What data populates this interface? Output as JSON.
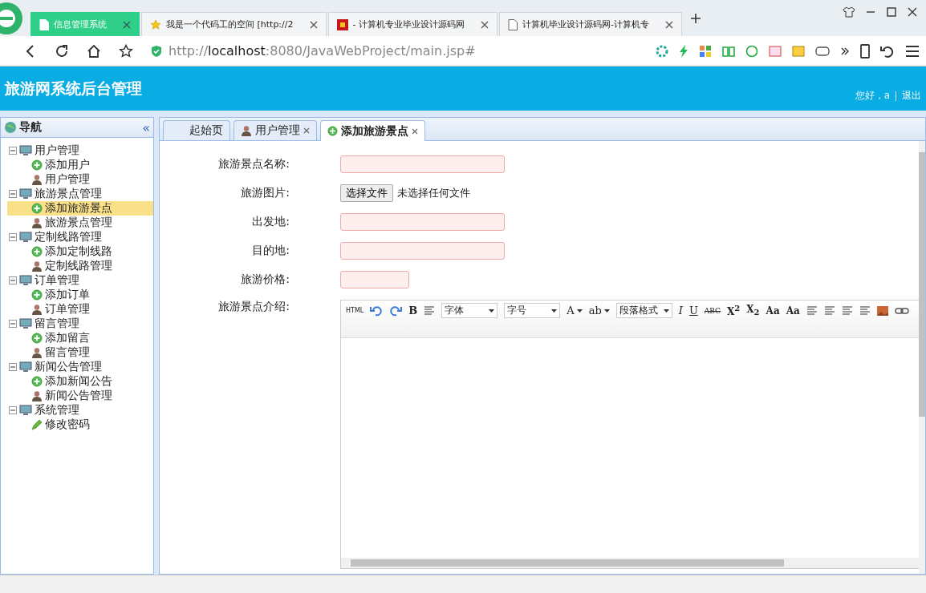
{
  "browser": {
    "tabs": [
      {
        "title": "信息管理系统",
        "selected": true,
        "kind": "page"
      },
      {
        "title": "我是一个代码工的空间 [http://2",
        "selected": false,
        "kind": "star"
      },
      {
        "title": "- 计算机专业毕业设计源码网",
        "selected": false,
        "kind": "favicon"
      },
      {
        "title": "计算机毕业设计源码网-计算机专",
        "selected": false,
        "kind": "page"
      }
    ],
    "url": "http://**localhost**:8080/JavaWebProject/main.jsp#"
  },
  "header": {
    "title": "旅游网系统后台管理",
    "greeting": "您好，a",
    "logout": "退出"
  },
  "nav": {
    "title": "导航",
    "collapse": "«",
    "tree": [
      {
        "label": "用户管理",
        "expanded": true,
        "children": [
          {
            "label": "添加用户",
            "kind": "add",
            "selected": false
          },
          {
            "label": "用户管理",
            "kind": "manage",
            "selected": false
          }
        ]
      },
      {
        "label": "旅游景点管理",
        "expanded": true,
        "children": [
          {
            "label": "添加旅游景点",
            "kind": "add",
            "selected": true
          },
          {
            "label": "旅游景点管理",
            "kind": "manage",
            "selected": false
          }
        ]
      },
      {
        "label": "定制线路管理",
        "expanded": true,
        "children": [
          {
            "label": "添加定制线路",
            "kind": "add",
            "selected": false
          },
          {
            "label": "定制线路管理",
            "kind": "manage",
            "selected": false
          }
        ]
      },
      {
        "label": "订单管理",
        "expanded": true,
        "children": [
          {
            "label": "添加订单",
            "kind": "add",
            "selected": false
          },
          {
            "label": "订单管理",
            "kind": "manage",
            "selected": false
          }
        ]
      },
      {
        "label": "留言管理",
        "expanded": true,
        "children": [
          {
            "label": "添加留言",
            "kind": "add",
            "selected": false
          },
          {
            "label": "留言管理",
            "kind": "manage",
            "selected": false
          }
        ]
      },
      {
        "label": "新闻公告管理",
        "expanded": true,
        "children": [
          {
            "label": "添加新闻公告",
            "kind": "add",
            "selected": false
          },
          {
            "label": "新闻公告管理",
            "kind": "manage",
            "selected": false
          }
        ]
      },
      {
        "label": "系统管理",
        "expanded": true,
        "children": [
          {
            "label": "修改密码",
            "kind": "edit",
            "selected": false
          }
        ]
      }
    ]
  },
  "tabs": [
    {
      "label": "起始页",
      "kind": "plain",
      "closable": false,
      "selected": false
    },
    {
      "label": "用户管理",
      "kind": "manage",
      "closable": true,
      "selected": false
    },
    {
      "label": "添加旅游景点",
      "kind": "add",
      "closable": true,
      "selected": true
    }
  ],
  "form": [
    {
      "label": "旅游景点名称:",
      "kind": "text"
    },
    {
      "label": "旅游图片:",
      "kind": "file",
      "button": "选择文件",
      "status": "未选择任何文件"
    },
    {
      "label": "出发地:",
      "kind": "text"
    },
    {
      "label": "目的地:",
      "kind": "text"
    },
    {
      "label": "旅游价格:",
      "kind": "short"
    },
    {
      "label": "旅游景点介绍:",
      "kind": "editor"
    }
  ],
  "editor_toolbar": [
    {
      "kind": "text",
      "label": "HTML"
    },
    {
      "kind": "undo"
    },
    {
      "kind": "redo"
    },
    {
      "kind": "bold",
      "label": "B"
    },
    {
      "kind": "lines"
    },
    {
      "kind": "select",
      "label": "字体"
    },
    {
      "kind": "select",
      "label": "字号"
    },
    {
      "kind": "dropdown",
      "label": "A"
    },
    {
      "kind": "dropdown",
      "label": "ab"
    },
    {
      "kind": "select",
      "label": "段落格式"
    },
    {
      "kind": "italic",
      "label": "I"
    },
    {
      "kind": "underline",
      "label": "U"
    },
    {
      "kind": "strike",
      "label": "ABC"
    },
    {
      "kind": "script",
      "label": "X$^{2}$"
    },
    {
      "kind": "script",
      "label": "X$_{2}$"
    },
    {
      "kind": "script",
      "label": "Aa"
    },
    {
      "kind": "script",
      "label": "Aa"
    },
    {
      "kind": "lines"
    },
    {
      "kind": "lines"
    },
    {
      "kind": "lines"
    },
    {
      "kind": "lines"
    },
    {
      "kind": "image"
    },
    {
      "kind": "link"
    }
  ]
}
